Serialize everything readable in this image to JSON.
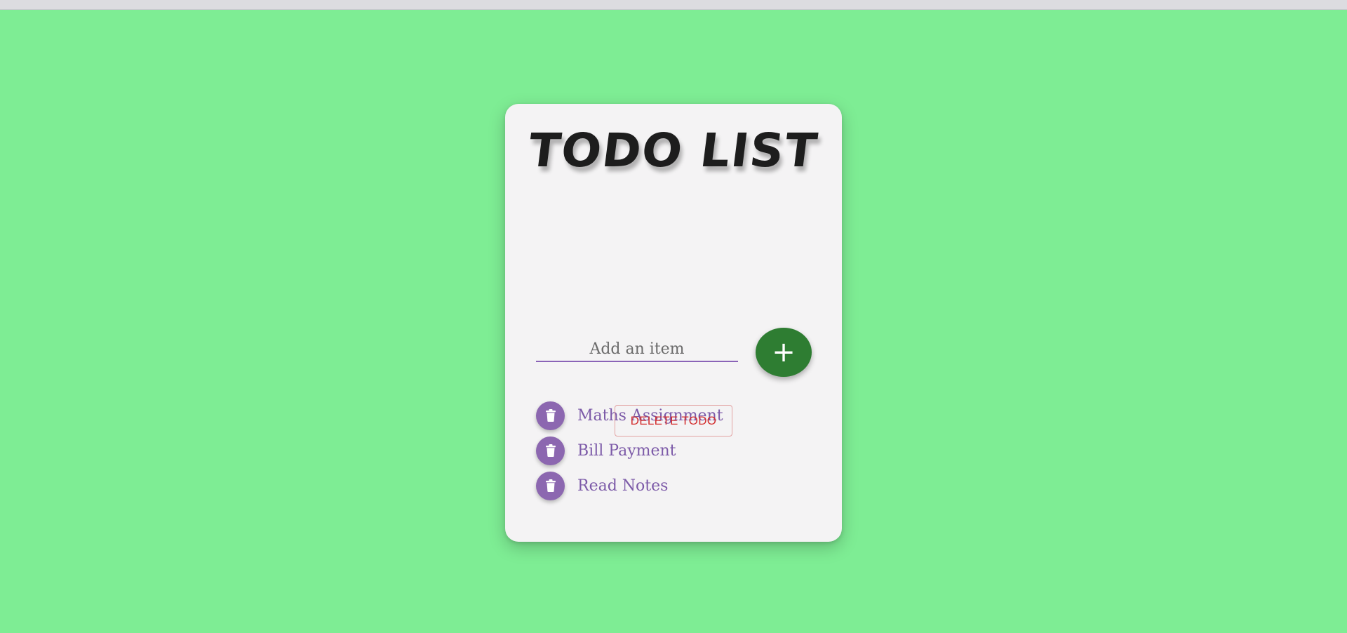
{
  "page": {
    "title": "TODO LIST"
  },
  "input": {
    "placeholder": "Add an item",
    "value": ""
  },
  "add_button": {
    "label": "+",
    "icon": "plus-icon"
  },
  "todos": [
    {
      "text": "Maths Assignment",
      "icon": "trash-icon"
    },
    {
      "text": "Bill Payment",
      "icon": "trash-icon"
    },
    {
      "text": "Read Notes",
      "icon": "trash-icon"
    }
  ],
  "delete_all_button": {
    "label": "DELETE TODO"
  },
  "colors": {
    "background": "#7eed94",
    "card": "#f4f3f4",
    "accent_purple": "#8c67b0",
    "add_green": "#2e7d32",
    "danger_red": "#d32f2f"
  }
}
